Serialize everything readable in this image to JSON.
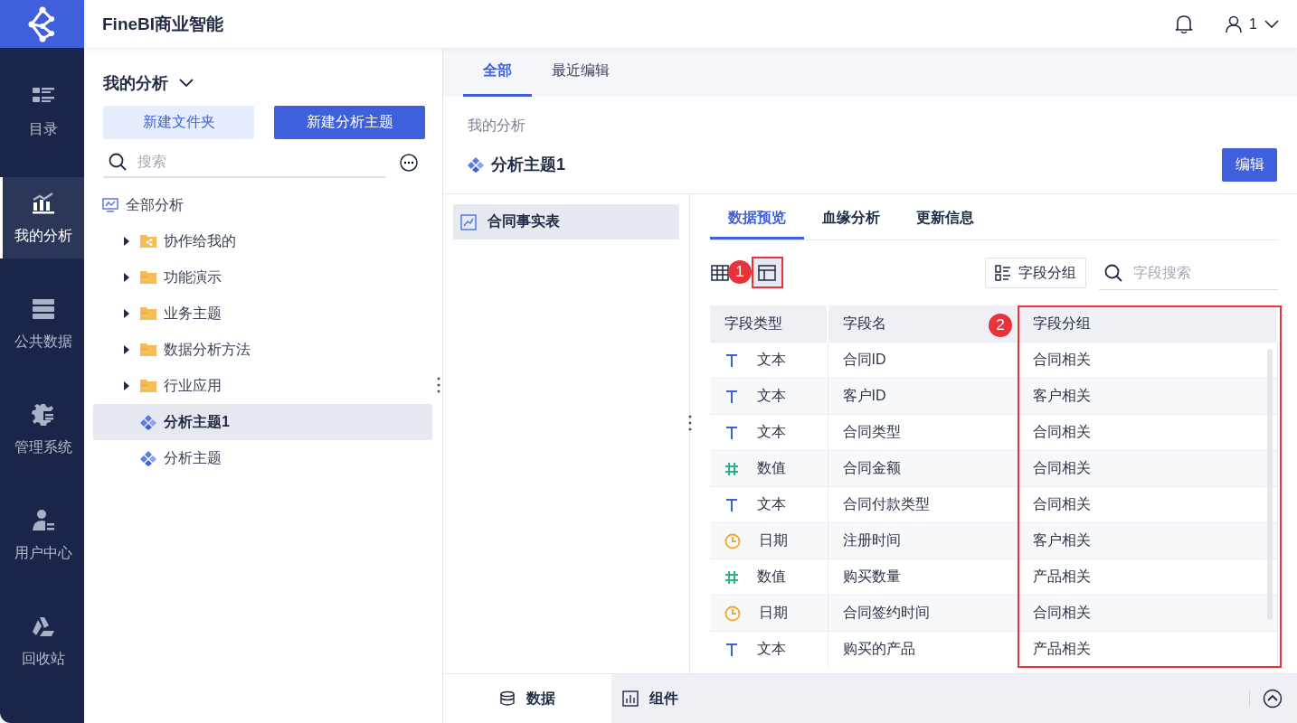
{
  "app": {
    "title": "FineBI商业智能"
  },
  "header": {
    "user": "1"
  },
  "nav": [
    {
      "label": "目录",
      "selected": false
    },
    {
      "label": "我的分析",
      "selected": true
    },
    {
      "label": "公共数据",
      "selected": false
    },
    {
      "label": "管理系统",
      "selected": false
    },
    {
      "label": "用户中心",
      "selected": false
    },
    {
      "label": "回收站",
      "selected": false
    }
  ],
  "sidebar": {
    "title": "我的分析",
    "buttons": [
      {
        "label": "新建文件夹",
        "kind": "secondary"
      },
      {
        "label": "新建分析主题",
        "kind": "primary"
      }
    ],
    "search": {
      "placeholder": "搜索"
    },
    "tree": [
      {
        "label": "全部分析",
        "kind": "root",
        "selected": false,
        "children": [
          {
            "label": "协作给我的",
            "kind": "shared-folder",
            "expanded": false,
            "selected": false
          },
          {
            "label": "功能演示",
            "kind": "folder",
            "expanded": false,
            "selected": false
          },
          {
            "label": "业务主题",
            "kind": "folder",
            "expanded": false,
            "selected": false
          },
          {
            "label": "数据分析方法",
            "kind": "folder",
            "expanded": false,
            "selected": false
          },
          {
            "label": "行业应用",
            "kind": "folder",
            "expanded": false,
            "selected": false
          },
          {
            "label": "分析主题1",
            "kind": "theme",
            "selected": true
          },
          {
            "label": "分析主题",
            "kind": "theme",
            "selected": false
          }
        ]
      }
    ]
  },
  "main": {
    "tabs": [
      {
        "label": "全部",
        "selected": true
      },
      {
        "label": "最近编辑",
        "selected": false
      }
    ],
    "breadcrumb": "我的分析",
    "title": "分析主题1",
    "edit_button": "编辑",
    "tables": [
      {
        "label": "合同事实表",
        "selected": true
      }
    ],
    "detail_tabs": [
      {
        "label": "数据预览",
        "selected": true
      },
      {
        "label": "血缘分析",
        "selected": false
      },
      {
        "label": "更新信息",
        "selected": false
      }
    ],
    "views": [
      {
        "kind": "grid",
        "selected": false
      },
      {
        "kind": "layout",
        "selected": true
      }
    ],
    "group_button": "字段分组",
    "field_search": {
      "placeholder": "字段搜索"
    },
    "table": {
      "columns": [
        "字段类型",
        "字段名",
        "字段分组"
      ],
      "rows": [
        {
          "kind": "text",
          "type": "文本",
          "name": "合同ID",
          "group": "合同相关"
        },
        {
          "kind": "text",
          "type": "文本",
          "name": "客户ID",
          "group": "客户相关"
        },
        {
          "kind": "text",
          "type": "文本",
          "name": "合同类型",
          "group": "合同相关"
        },
        {
          "kind": "number",
          "type": "数值",
          "name": "合同金额",
          "group": "合同相关"
        },
        {
          "kind": "text",
          "type": "文本",
          "name": "合同付款类型",
          "group": "合同相关"
        },
        {
          "kind": "date",
          "type": "日期",
          "name": "注册时间",
          "group": "客户相关"
        },
        {
          "kind": "number",
          "type": "数值",
          "name": "购买数量",
          "group": "产品相关"
        },
        {
          "kind": "date",
          "type": "日期",
          "name": "合同签约时间",
          "group": "合同相关"
        },
        {
          "kind": "text",
          "type": "文本",
          "name": "购买的产品",
          "group": "产品相关"
        }
      ]
    }
  },
  "annotations": [
    {
      "label": "1"
    },
    {
      "label": "2"
    }
  ],
  "bottom_tabs": [
    {
      "label": "数据",
      "selected": true
    },
    {
      "label": "组件",
      "selected": false
    }
  ]
}
